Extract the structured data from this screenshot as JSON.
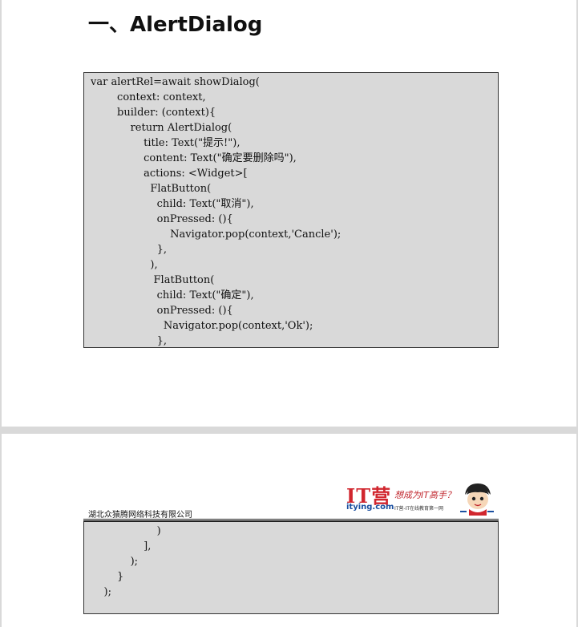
{
  "page1": {
    "heading": "一、AlertDialog",
    "code_lines": [
      "var alertRel=await showDialog(",
      "        context: context,",
      "        builder: (context){",
      "            return AlertDialog(",
      "                title: Text(\"提示!\"),",
      "                content: Text(\"确定要删除吗\"),",
      "                actions: <Widget>[",
      "                  FlatButton(",
      "                    child: Text(\"取消\"),",
      "                    onPressed: (){",
      "                        Navigator.pop(context,'Cancle');",
      "                    },",
      "                  ),",
      "                   FlatButton(",
      "                    child: Text(\"确定\"),",
      "                    onPressed: (){",
      "                      Navigator.pop(context,'Ok');",
      "                    },"
    ]
  },
  "page2": {
    "header": {
      "company": "湖北众猿腾网络科技有限公司",
      "logo_it": "IT营",
      "logo_domain": "itying.com",
      "logo_slogan": "想成为IT高手？",
      "logo_sub": "IT营-IT在线教育第一网"
    },
    "code_lines": [
      "                    )",
      "                ],",
      "            );",
      "        }",
      "    );"
    ]
  },
  "colors": {
    "code_background": "#d9d9d9",
    "logo_red": "#d1262e",
    "logo_blue": "#1a4fa0"
  }
}
